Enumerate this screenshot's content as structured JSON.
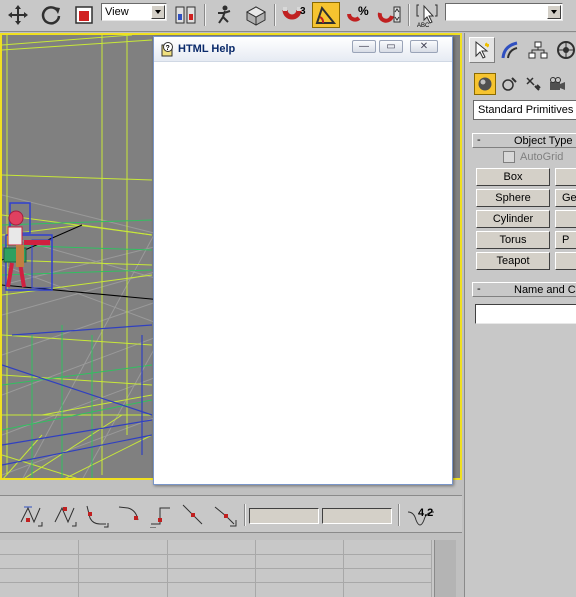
{
  "toolbar": {
    "view_select": "View",
    "snap_angle_label": "3",
    "percent_snap_label": "%",
    "named_selection_value": "",
    "icons": [
      "move-icon",
      "rotate-icon",
      "scale-icon",
      "view-dropdown",
      "pivot-icon",
      "select-manipulate-icon",
      "keyboard-shortcut-icon",
      "snap-3d-icon",
      "angle-snap-icon",
      "percent-snap-icon",
      "spinner-snap-icon",
      "edit-named-selection-icon"
    ]
  },
  "help_window": {
    "title": "HTML Help",
    "minimize_glyph": "—",
    "maximize_glyph": "▭",
    "close_glyph": "✕"
  },
  "curve_bar": {
    "value_label": "4.2",
    "field1": "",
    "field2": ""
  },
  "command_panel": {
    "category": "Standard Primitives",
    "object_type_header": "Object Type",
    "autogrid_label": "AutoGrid",
    "name_color_header": "Name and Color",
    "rollout_minus": "-",
    "buttons_left": [
      "Box",
      "Sphere",
      "Cylinder",
      "Torus",
      "Teapot"
    ],
    "buttons_right": [
      "",
      "Ge",
      "",
      "P",
      ""
    ],
    "name_value": ""
  },
  "colors": {
    "active_highlight": "#f6c430",
    "viewport_border": "#f0e020",
    "viewport_bg": "#808080",
    "toolbar_bg": "#c8c8c8"
  }
}
